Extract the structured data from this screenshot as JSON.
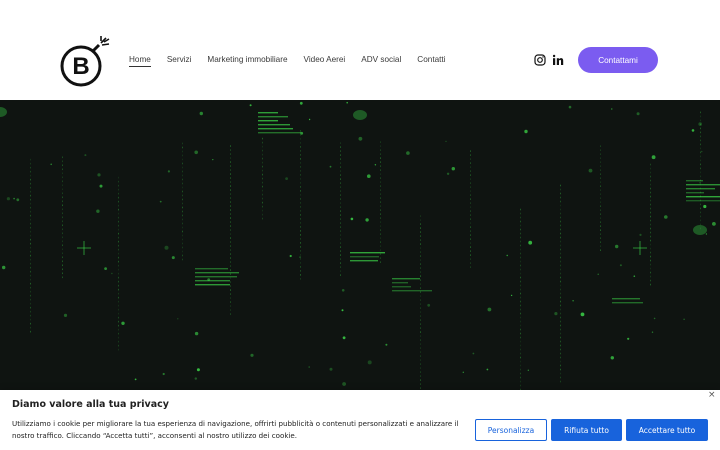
{
  "header": {
    "logo_alt": "B",
    "nav": [
      "Home",
      "Servizi",
      "Marketing immobiliare",
      "Video Aerei",
      "ADV social",
      "Contatti"
    ],
    "active_nav": "Home",
    "social_icons": [
      "instagram-icon",
      "linkedin-icon"
    ],
    "cta_label": "Contattami"
  },
  "hero": {
    "background": "#0f1411",
    "accent": "#3ddc4a"
  },
  "cookie": {
    "title": "Diamo valore alla tua privacy",
    "text": "Utilizziamo i cookie per migliorare la tua esperienza di navigazione, offrirti pubblicità o contenuti personalizzati e analizzare il nostro traffico. Cliccando “Accetta tutti”, acconsenti al nostro utilizzo dei cookie.",
    "close_symbol": "×",
    "buttons": {
      "customize": "Personalizza",
      "reject": "Rifiuta tutto",
      "accept": "Accettare tutto"
    }
  },
  "colors": {
    "brand_purple": "#7b5cf0",
    "cookie_blue": "#1863dc"
  }
}
